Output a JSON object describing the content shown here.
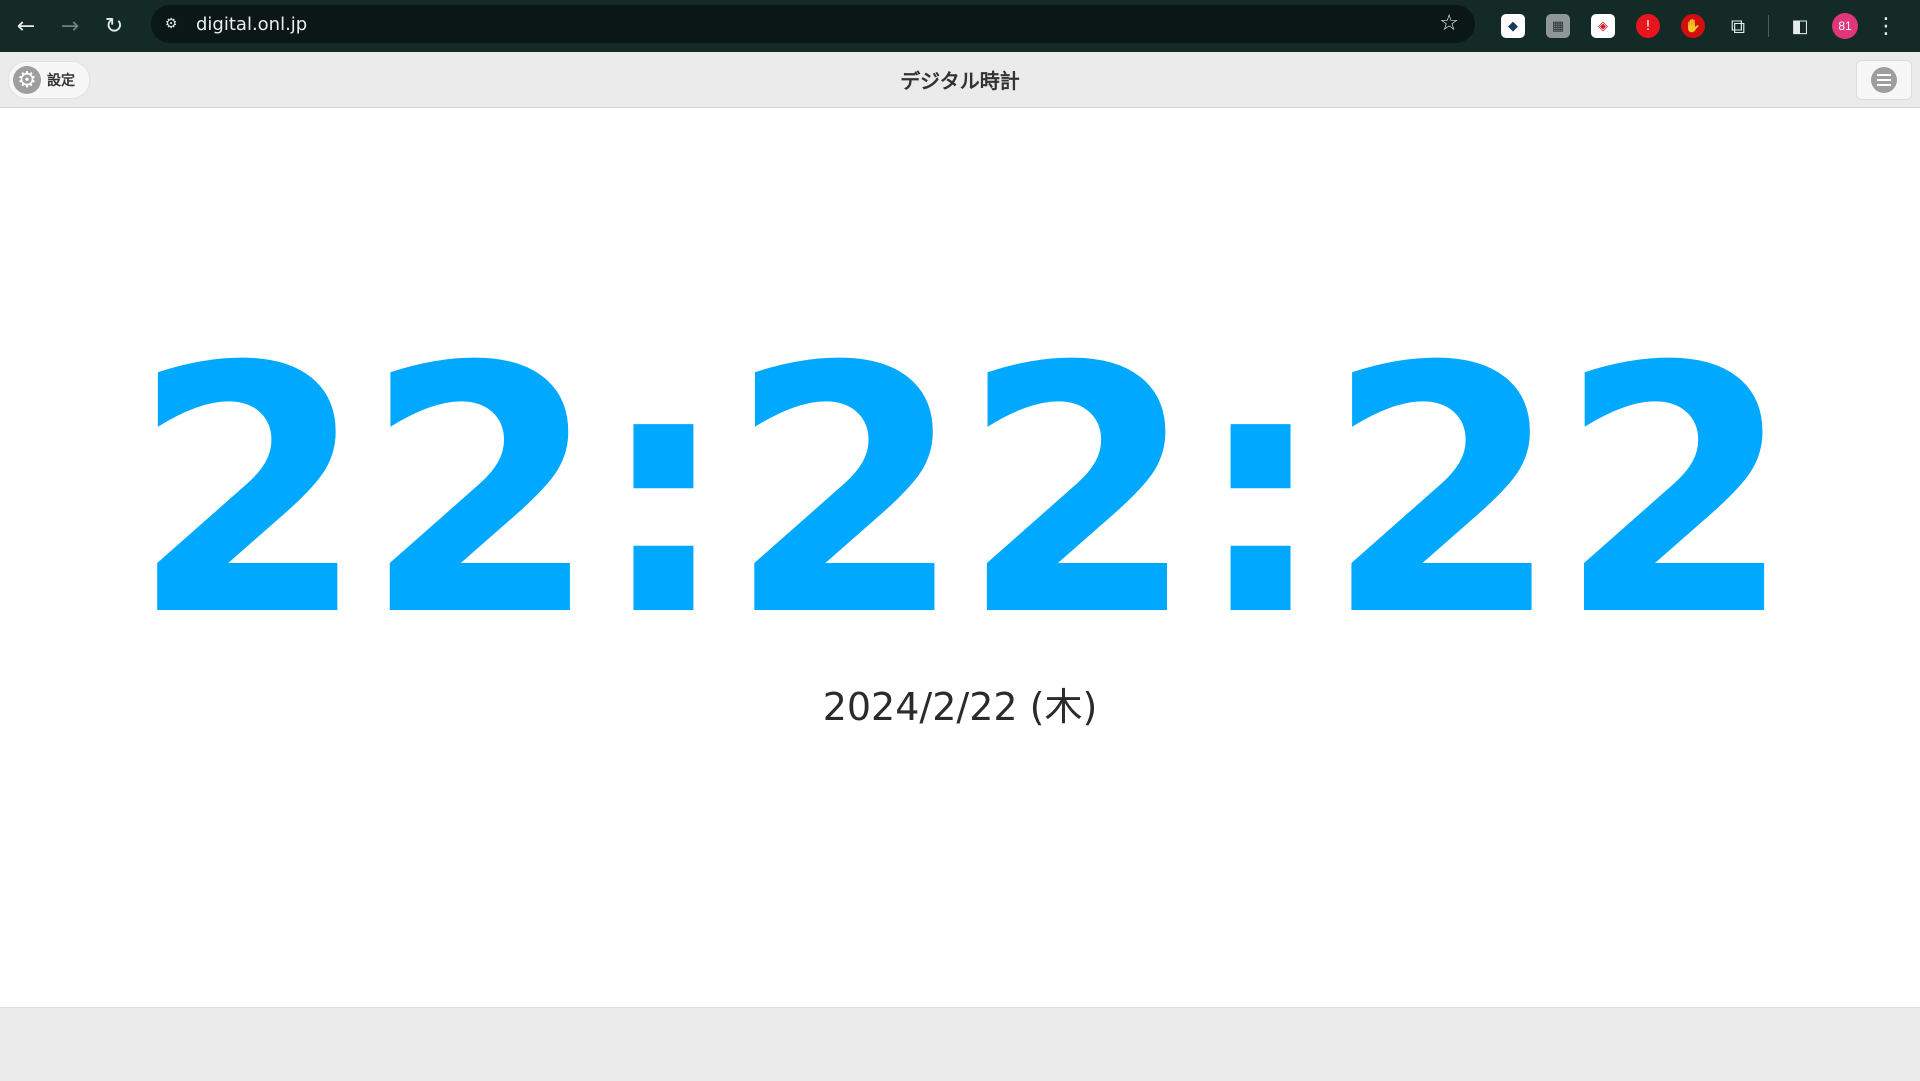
{
  "browser": {
    "back_glyph": "←",
    "forward_glyph": "→",
    "reload_glyph": "↻",
    "site_info_glyph": "⚙",
    "url": "digital.onl.jp",
    "bookmark_glyph": "☆",
    "extensions": [
      {
        "name": "extension-1-icon",
        "glyph": "◆"
      },
      {
        "name": "extension-2-icon",
        "glyph": "▦"
      },
      {
        "name": "extension-3-icon",
        "glyph": "◈"
      },
      {
        "name": "extension-4-icon",
        "glyph": "!"
      },
      {
        "name": "extension-5-icon",
        "glyph": "✋"
      }
    ],
    "puzzle_glyph": "⧉",
    "sidepanel_glyph": "◧",
    "profile_label": "81",
    "menu_glyph": "⋮"
  },
  "header": {
    "settings_label": "設定",
    "gear_glyph": "⚙",
    "title": "デジタル時計"
  },
  "clock": {
    "time": "22:22:22",
    "date": "2024/2/22 (木)",
    "color": "#00a8ff"
  },
  "colors": {
    "chrome_bg": "#142a27",
    "header_bg": "#ebebeb",
    "footer_bg": "#ebebeb",
    "profile_avatar": "#e0367a"
  }
}
